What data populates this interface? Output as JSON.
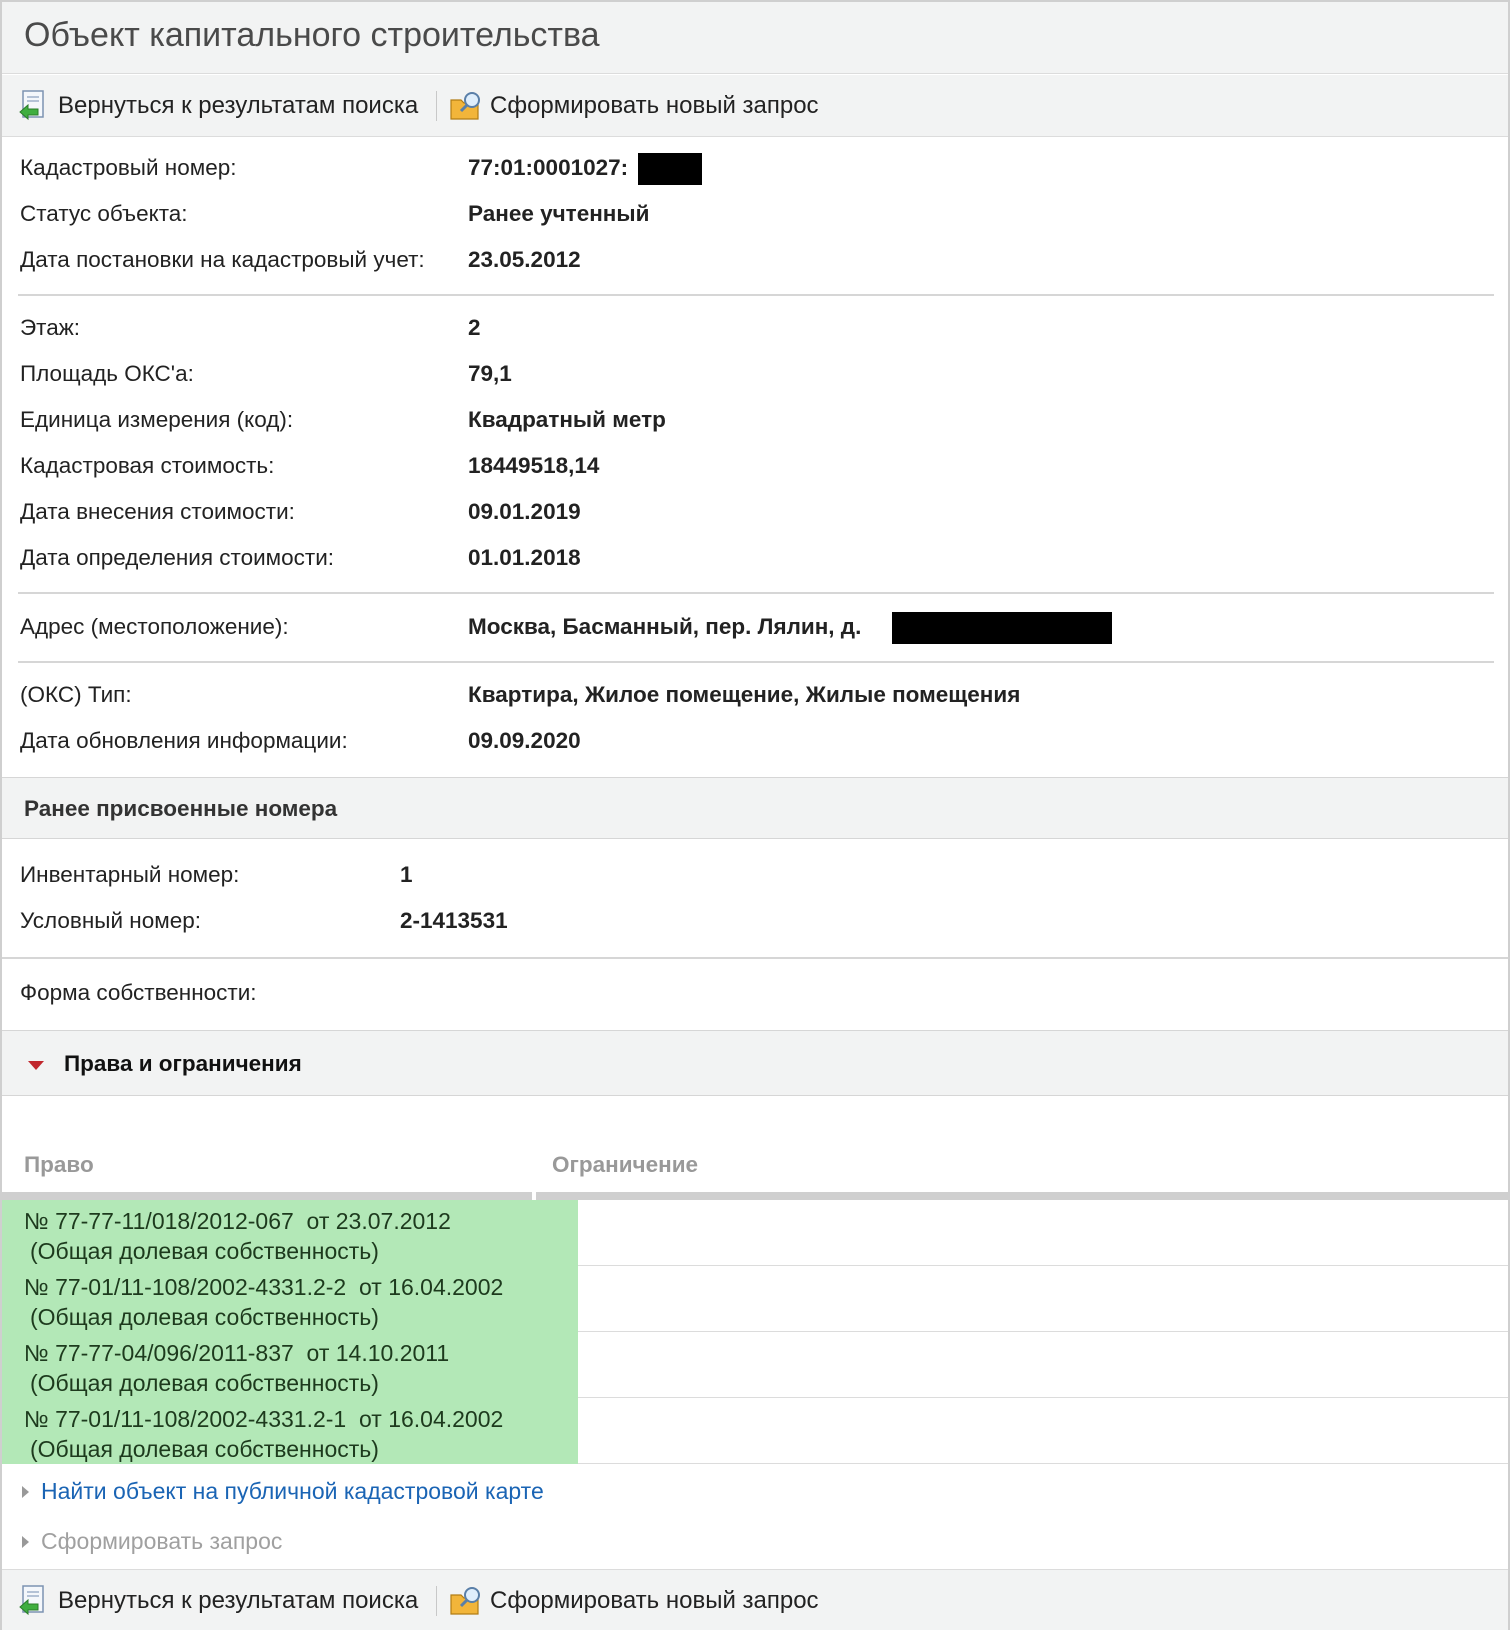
{
  "page_title": "Объект капитального строительства",
  "toolbar": {
    "back_label": "Вернуться к результатам поиска",
    "new_request_label": "Сформировать новый запрос"
  },
  "fields_group1": [
    {
      "label": "Кадастровый номер:",
      "value": "77:01:0001027:"
    },
    {
      "label": "Статус объекта:",
      "value": "Ранее учтенный"
    },
    {
      "label": "Дата постановки на кадастровый учет:",
      "value": "23.05.2012"
    }
  ],
  "fields_group2": [
    {
      "label": "Этаж:",
      "value": "2"
    },
    {
      "label": "Площадь ОКС'а:",
      "value": "79,1"
    },
    {
      "label": "Единица измерения (код):",
      "value": "Квадратный метр"
    },
    {
      "label": "Кадастровая стоимость:",
      "value": "18449518,14"
    },
    {
      "label": "Дата внесения стоимости:",
      "value": "09.01.2019"
    },
    {
      "label": "Дата определения стоимости:",
      "value": "01.01.2018"
    }
  ],
  "fields_group3": [
    {
      "label": "Адрес (местоположение):",
      "value": "Москва, Басманный, пер. Лялин, д."
    }
  ],
  "fields_group4": [
    {
      "label": "(ОКС) Тип:",
      "value": "Квартира, Жилое помещение, Жилые помещения"
    },
    {
      "label": "Дата обновления информации:",
      "value": "09.09.2020"
    }
  ],
  "prev_numbers": {
    "title": "Ранее присвоенные номера",
    "items": [
      {
        "label": "Инвентарный номер:",
        "value": "1"
      },
      {
        "label": "Условный номер:",
        "value": "2-1413531"
      }
    ]
  },
  "ownership_form_label": "Форма собственности:",
  "rights": {
    "title": "Права и ограничения",
    "col_right": "Право",
    "col_restriction": "Ограничение",
    "rows": [
      {
        "line1": "№ 77-77-11/018/2012-067  от 23.07.2012",
        "line2": "(Общая долевая собственность)"
      },
      {
        "line1": "№ 77-01/11-108/2002-4331.2-2  от 16.04.2002",
        "line2": "(Общая долевая собственность)"
      },
      {
        "line1": "№ 77-77-04/096/2011-837  от 14.10.2011",
        "line2": "(Общая долевая собственность)"
      },
      {
        "line1": "№ 77-01/11-108/2002-4331.2-1  от 16.04.2002",
        "line2": "(Общая долевая собственность)"
      }
    ]
  },
  "links": {
    "find_on_map": "Найти объект на публичной кадастровой карте",
    "make_request": "Сформировать запрос"
  },
  "colors": {
    "right_cell_bg": "#b3e8b7",
    "link": "#1a64b4",
    "header_bg": "#f2f3f3",
    "triangle": "#c1272d"
  },
  "icons": {
    "back": "document-back-arrow-icon",
    "new_request": "folder-magnifier-icon",
    "expand": "triangle-down-icon",
    "link_bullet": "triangle-right-icon"
  }
}
